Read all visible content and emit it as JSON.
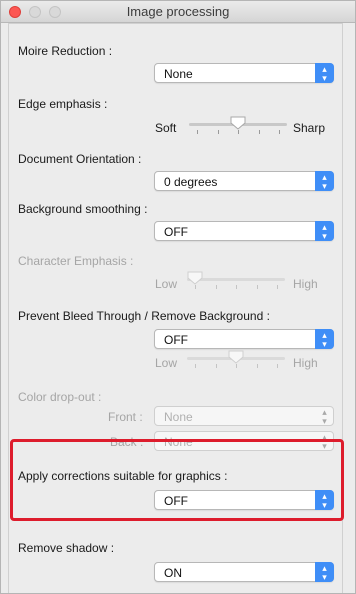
{
  "window": {
    "title": "Image processing"
  },
  "moire": {
    "label": "Moire Reduction :",
    "value": "None"
  },
  "edge": {
    "label": "Edge emphasis :",
    "low": "Soft",
    "high": "Sharp",
    "level": 0.5
  },
  "orientation": {
    "label": "Document Orientation :",
    "value": "0 degrees"
  },
  "background": {
    "label": "Background smoothing :",
    "value": "OFF"
  },
  "character": {
    "label": "Character Emphasis :",
    "low": "Low",
    "high": "High",
    "level": 0.0
  },
  "bleed": {
    "label": "Prevent Bleed Through / Remove Background :",
    "value": "OFF",
    "low": "Low",
    "high": "High",
    "level": 0.5
  },
  "dropout": {
    "label": "Color drop-out :",
    "front_label": "Front :",
    "front_value": "None",
    "back_label": "Back :",
    "back_value": "None"
  },
  "graphics": {
    "label": "Apply corrections suitable for graphics :",
    "value": "OFF"
  },
  "shadow": {
    "label": "Remove shadow :",
    "value": "ON"
  },
  "colors": {
    "accent": "#3f8ef7",
    "highlight": "#dd1c2c",
    "close": "#fc5753"
  }
}
